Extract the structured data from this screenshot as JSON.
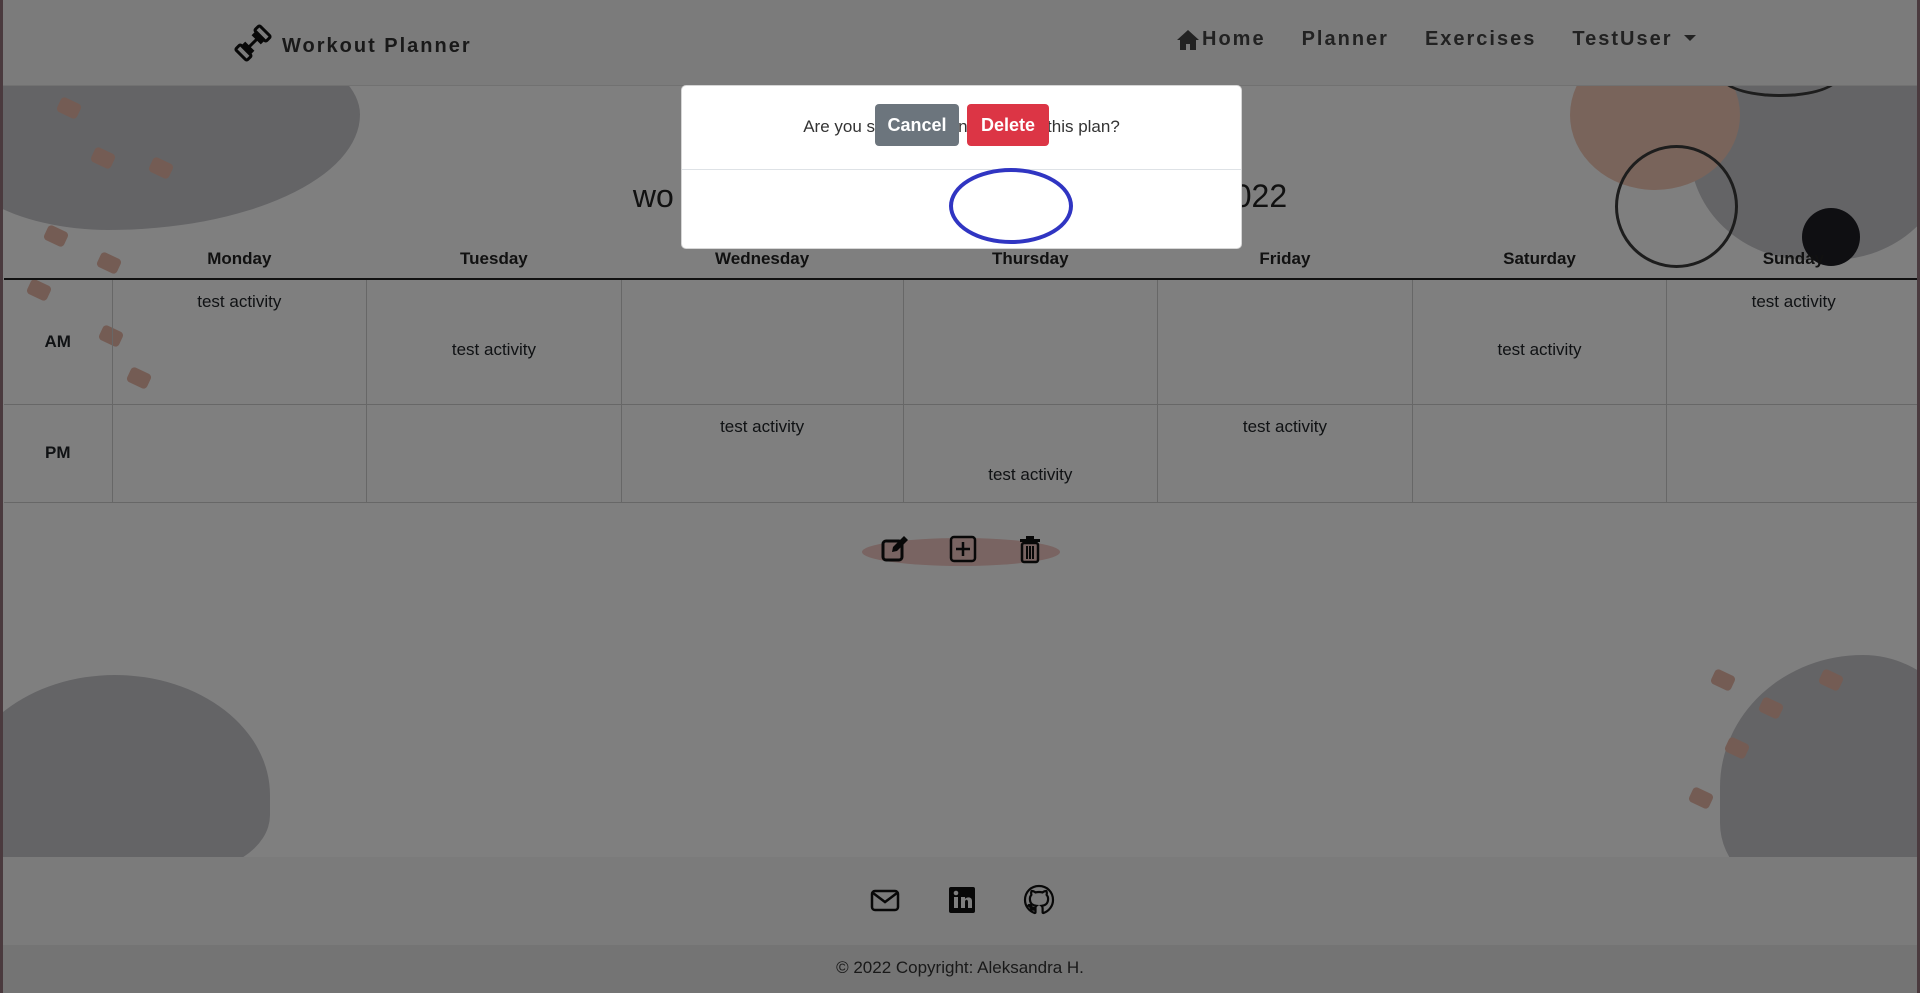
{
  "brand": {
    "name": "Workout Planner"
  },
  "nav": {
    "home": "Home",
    "planner": "Planner",
    "exercises": "Exercises",
    "user": "TestUser"
  },
  "plan": {
    "title_left": "wo",
    "title_right": "022",
    "days": [
      "Monday",
      "Tuesday",
      "Wednesday",
      "Thursday",
      "Friday",
      "Saturday",
      "Sunday"
    ],
    "rows": [
      {
        "label": "AM",
        "cells": [
          "test activity",
          "test activity",
          "",
          "",
          "",
          "test activity",
          "test activity"
        ]
      },
      {
        "label": "PM",
        "cells": [
          "",
          "",
          "test activity",
          "test activity",
          "test activity",
          "",
          ""
        ]
      }
    ]
  },
  "actions": {
    "edit": "edit-icon",
    "add": "plus-square-icon",
    "delete": "trash-icon"
  },
  "modal": {
    "message": "Are you sure you want to delete this plan?",
    "cancel_label": "Cancel",
    "delete_label": "Delete"
  },
  "footer": {
    "social": [
      "envelope-icon",
      "linkedin-icon",
      "github-icon"
    ],
    "copyright": "© 2022 Copyright: Aleksandra H."
  },
  "colors": {
    "delete": "#dc3545",
    "cancel": "#6c757d",
    "highlight": "#3035c2",
    "accent_pink": "#f2c9b6"
  }
}
